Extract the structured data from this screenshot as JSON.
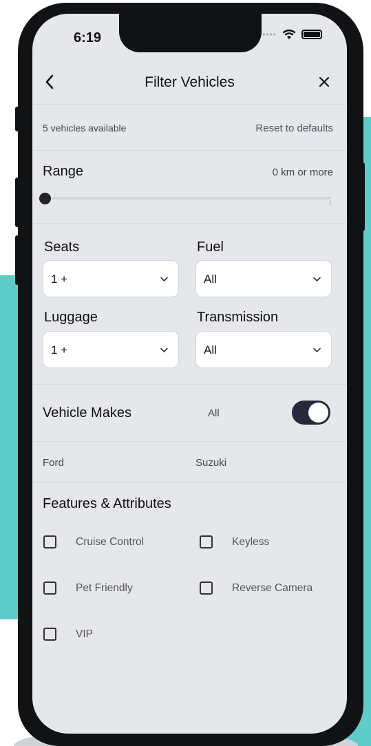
{
  "status": {
    "time": "6:19"
  },
  "nav": {
    "title": "Filter Vehicles"
  },
  "summary": {
    "available": "5 vehicles available",
    "reset": "Reset to defaults"
  },
  "range": {
    "label": "Range",
    "value_text": "0 km or more",
    "level": 0
  },
  "selects": {
    "seats": {
      "label": "Seats",
      "value": "1 +"
    },
    "fuel": {
      "label": "Fuel",
      "value": "All"
    },
    "luggage": {
      "label": "Luggage",
      "value": "1 +"
    },
    "transmission": {
      "label": "Transmission",
      "value": "All"
    }
  },
  "makes": {
    "label": "Vehicle Makes",
    "all_label": "All",
    "all_on": true,
    "items": [
      "Ford",
      "Suzuki"
    ]
  },
  "features": {
    "label": "Features & Attributes",
    "items": [
      {
        "label": "Cruise Control",
        "checked": false
      },
      {
        "label": "Keyless",
        "checked": false
      },
      {
        "label": "Pet Friendly",
        "checked": false
      },
      {
        "label": "Reverse Camera",
        "checked": false
      },
      {
        "label": "VIP",
        "checked": false
      }
    ]
  },
  "colors": {
    "background_accent": "#5ecdc9",
    "screen_bg": "#e5e7ea",
    "toggle_on": "#26293a",
    "frame": "#111214"
  }
}
